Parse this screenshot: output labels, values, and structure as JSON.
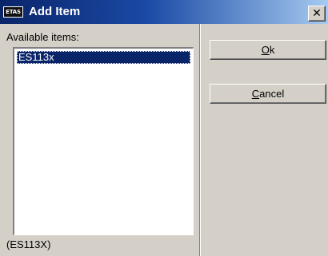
{
  "window": {
    "title": "Add Item",
    "icon_text": "ETAS",
    "close_glyph": "✕"
  },
  "list": {
    "label": "Available items:",
    "items": [
      "ES113x"
    ],
    "selected_index": 0
  },
  "status": "(ES113X)",
  "buttons": {
    "ok": {
      "mnemonic": "O",
      "rest": "k"
    },
    "cancel": {
      "mnemonic": "C",
      "rest": "ancel"
    }
  },
  "colors": {
    "title_start": "#0a246a",
    "title_end": "#a6caf0",
    "selection": "#0a246a",
    "face": "#d4d0c8"
  }
}
